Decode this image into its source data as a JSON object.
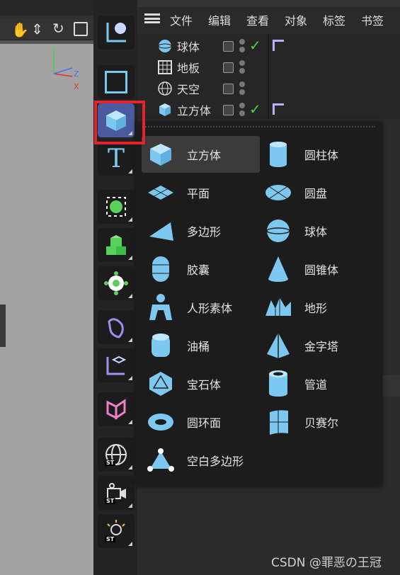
{
  "menubar": {
    "items": [
      "文件",
      "编辑",
      "查看",
      "对象",
      "标签",
      "书签"
    ]
  },
  "objects": [
    {
      "name": "球体",
      "icon": "sphere-icon",
      "checked": true
    },
    {
      "name": "地板",
      "icon": "floor-icon",
      "checked": false
    },
    {
      "name": "天空",
      "icon": "sky-icon",
      "checked": false
    },
    {
      "name": "立方体",
      "icon": "cube-icon",
      "checked": true
    }
  ],
  "primitives_menu": {
    "left": [
      "立方体",
      "平面",
      "多边形",
      "胶囊",
      "人形素体",
      "油桶",
      "宝石体",
      "圆环面",
      "空白多边形"
    ],
    "right": [
      "圆柱体",
      "圆盘",
      "球体",
      "圆锥体",
      "地形",
      "金字塔",
      "管道",
      "贝赛尔"
    ]
  },
  "watermark": "CSDN @罪恶の王冠",
  "colors": {
    "accent": "#7dc8f0",
    "highlight": "#e3242b",
    "panel": "#1c1c1c"
  }
}
